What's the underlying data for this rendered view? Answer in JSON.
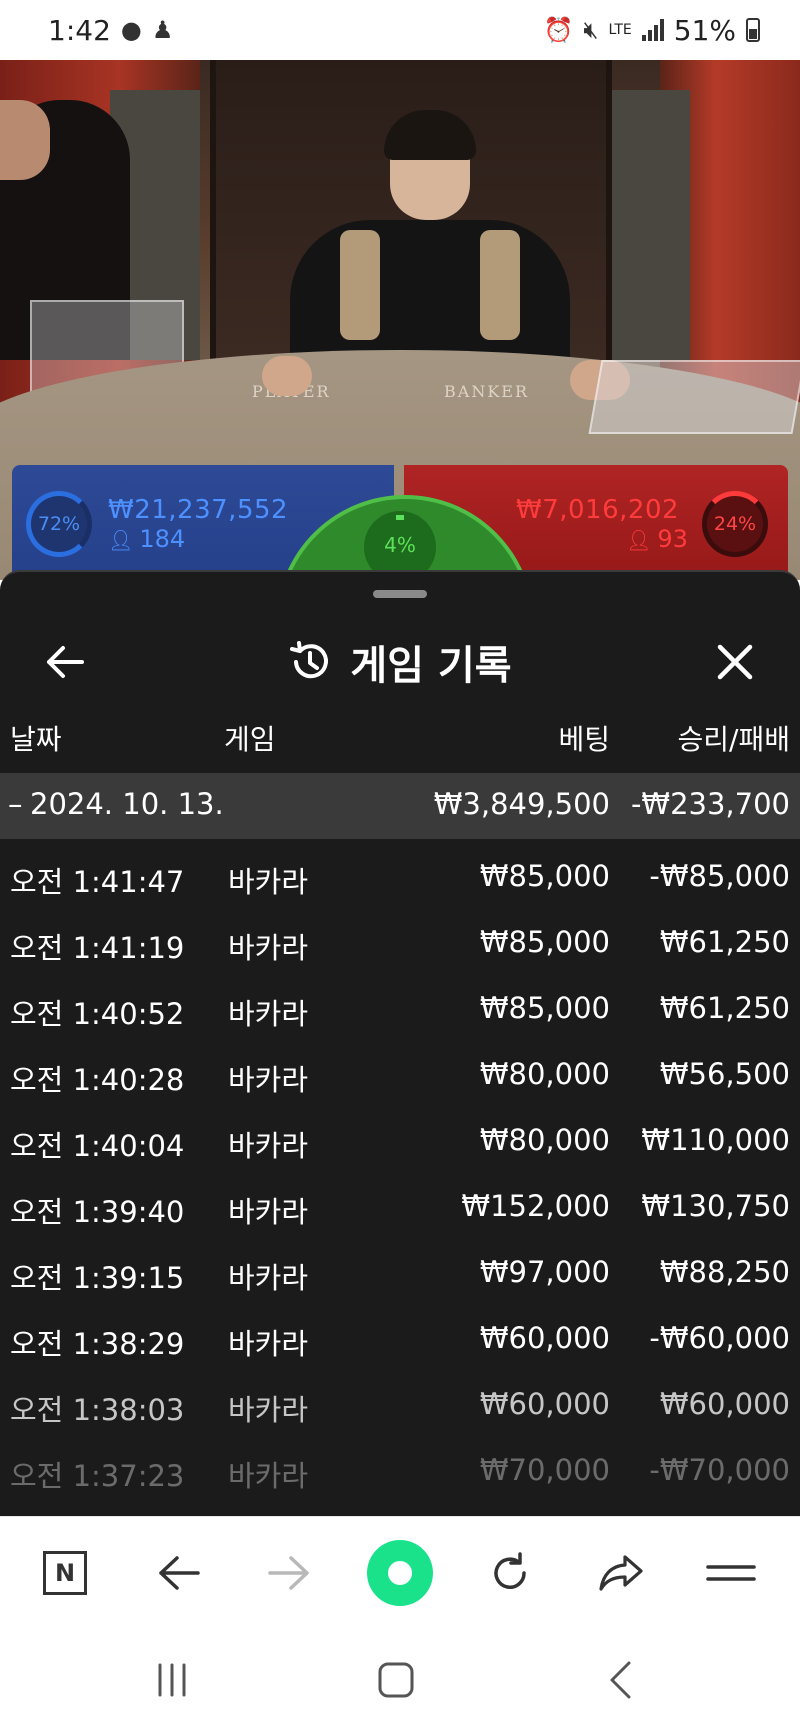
{
  "status_bar": {
    "time": "1:42",
    "network": "LTE",
    "battery": "51%"
  },
  "video": {
    "table_label_player": "PLAYER",
    "table_label_banker": "BANKER"
  },
  "bets": {
    "player_percent": "72%",
    "player_amount": "₩21,237,552",
    "player_count": "184",
    "tie_percent": "4%",
    "banker_amount": "₩7,016,202",
    "banker_count": "93",
    "banker_percent": "24%",
    "colors": {
      "player": "#4d90ff",
      "banker": "#ff3b3b",
      "tie": "#5de05a"
    }
  },
  "sheet": {
    "title": "게임 기록",
    "icons": {
      "back": "arrow-left-icon",
      "history": "history-icon",
      "close": "close-icon"
    },
    "columns": {
      "date": "날짜",
      "game": "게임",
      "bet": "베팅",
      "win_loss": "승리/패배"
    },
    "date_group": {
      "date": "2024. 10. 13.",
      "total_bet": "₩3,849,500",
      "total_win_loss": "-₩233,700"
    },
    "rows": [
      {
        "time": "오전 1:41:47",
        "game": "바카라",
        "bet": "₩85,000",
        "result": "-₩85,000"
      },
      {
        "time": "오전 1:41:19",
        "game": "바카라",
        "bet": "₩85,000",
        "result": "₩61,250"
      },
      {
        "time": "오전 1:40:52",
        "game": "바카라",
        "bet": "₩85,000",
        "result": "₩61,250"
      },
      {
        "time": "오전 1:40:28",
        "game": "바카라",
        "bet": "₩80,000",
        "result": "₩56,500"
      },
      {
        "time": "오전 1:40:04",
        "game": "바카라",
        "bet": "₩80,000",
        "result": "₩110,000"
      },
      {
        "time": "오전 1:39:40",
        "game": "바카라",
        "bet": "₩152,000",
        "result": "₩130,750"
      },
      {
        "time": "오전 1:39:15",
        "game": "바카라",
        "bet": "₩97,000",
        "result": "₩88,250"
      },
      {
        "time": "오전 1:38:29",
        "game": "바카라",
        "bet": "₩60,000",
        "result": "-₩60,000"
      },
      {
        "time": "오전 1:38:03",
        "game": "바카라",
        "bet": "₩60,000",
        "result": "₩60,000"
      },
      {
        "time": "오전 1:37:23",
        "game": "바카라",
        "bet": "₩70,000",
        "result": "-₩70,000"
      }
    ]
  },
  "browser_toolbar": {
    "n_label": "N",
    "home_color": "#19e28a",
    "icons": [
      "n-logo-icon",
      "back-arrow-icon",
      "forward-arrow-icon",
      "home-icon",
      "refresh-icon",
      "share-icon",
      "menu-icon"
    ]
  },
  "nav_bar": {
    "icons": [
      "recent-apps-icon",
      "home-icon",
      "back-icon"
    ]
  }
}
